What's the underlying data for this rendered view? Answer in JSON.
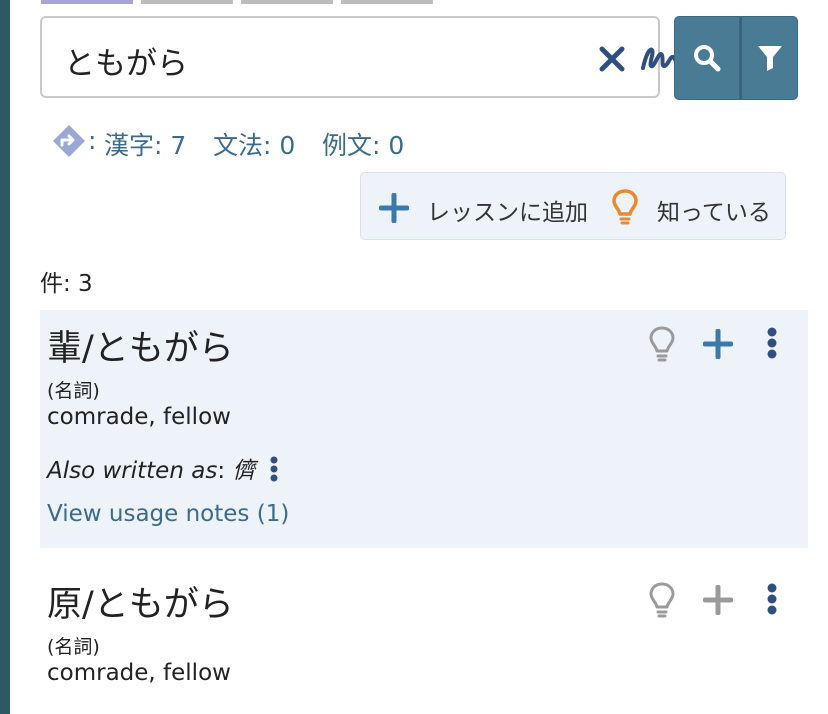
{
  "search": {
    "query": "ともがら"
  },
  "counts": {
    "kanji": "漢字: 7",
    "grammar": "文法: 0",
    "examples": "例文: 0",
    "separator": ":"
  },
  "actions": {
    "add_to_lesson": "レッスンに追加",
    "i_know": "知っている"
  },
  "results": {
    "count_label": "件: 3",
    "entries": [
      {
        "headword": "輩/ともがら",
        "pos": "(名詞)",
        "gloss": "comrade, fellow",
        "also_label": "Also written as",
        "also_value": "儕",
        "notes_link": "View usage notes (1)"
      },
      {
        "headword": "原/ともがら",
        "pos": "(名詞)",
        "gloss": "comrade, fellow"
      }
    ]
  },
  "colors": {
    "accent": "#4a7b95",
    "link": "#3a6b8e",
    "highlight_bg": "#eef3fa",
    "bulb_orange": "#e98a2b",
    "plus_blue": "#3b78ac"
  }
}
